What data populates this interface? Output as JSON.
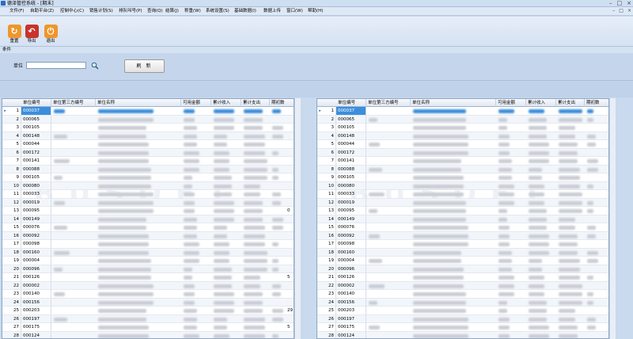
{
  "window": {
    "title": "德泽管控系统 - [期末]",
    "controls": [
      "–",
      "□",
      "×"
    ]
  },
  "menu": {
    "items": [
      "文件(F)",
      "自助平台(Z)",
      "控制中心(C)",
      "销售计划(S)",
      "排队叫号(P)",
      "查询(Q)",
      "结算(J)",
      "称重(W)",
      "系统设置(S)",
      "基础数据(I)",
      "数据上传",
      "窗口(W)",
      "帮助(H)"
    ],
    "mdi_controls": [
      "–",
      "□",
      "×"
    ]
  },
  "toolbar": {
    "buttons": [
      {
        "label": "重置",
        "icon": "reset-icon",
        "color": "#f0962a"
      },
      {
        "label": "导出",
        "icon": "export-icon",
        "color": "#c8332c"
      },
      {
        "label": "退出",
        "icon": "exit-icon",
        "color": "#f0962a"
      }
    ]
  },
  "conditions": {
    "label": "条件",
    "unit_label": "单位",
    "unit_value": "",
    "refresh_label": "刷 新"
  },
  "grid": {
    "columns": [
      "单位编号",
      "单位第三方编号",
      "单位名称",
      "可用金额",
      "累计收入",
      "累计支出",
      "期初数"
    ],
    "rows": [
      {
        "no": "1",
        "code": "000037"
      },
      {
        "no": "2",
        "code": "000065"
      },
      {
        "no": "3",
        "code": "000105"
      },
      {
        "no": "4",
        "code": "000148"
      },
      {
        "no": "5",
        "code": "000044"
      },
      {
        "no": "6",
        "code": "000172"
      },
      {
        "no": "7",
        "code": "000141"
      },
      {
        "no": "8",
        "code": "000088"
      },
      {
        "no": "9",
        "code": "000105"
      },
      {
        "no": "10",
        "code": "000080"
      },
      {
        "no": "11",
        "code": "000033"
      },
      {
        "no": "12",
        "code": "000019"
      },
      {
        "no": "13",
        "code": "000095"
      },
      {
        "no": "14",
        "code": "000149"
      },
      {
        "no": "15",
        "code": "000076"
      },
      {
        "no": "16",
        "code": "000092"
      },
      {
        "no": "17",
        "code": "000098"
      },
      {
        "no": "18",
        "code": "000160"
      },
      {
        "no": "19",
        "code": "000004"
      },
      {
        "no": "20",
        "code": "000096"
      },
      {
        "no": "21",
        "code": "000126"
      },
      {
        "no": "22",
        "code": "000002"
      },
      {
        "no": "23",
        "code": "000140"
      },
      {
        "no": "24",
        "code": "000156"
      },
      {
        "no": "25",
        "code": "000203"
      },
      {
        "no": "26",
        "code": "000197"
      },
      {
        "no": "27",
        "code": "000175"
      },
      {
        "no": "28",
        "code": "000124"
      }
    ],
    "left_extras": {
      "13": "0",
      "21": "5",
      "25": "29",
      "27": "5"
    },
    "selected_row_indicator": "▸"
  },
  "colors": {
    "selected": "#3b8edc",
    "header": "#e1e8f2",
    "background": "#c9d9ee"
  }
}
